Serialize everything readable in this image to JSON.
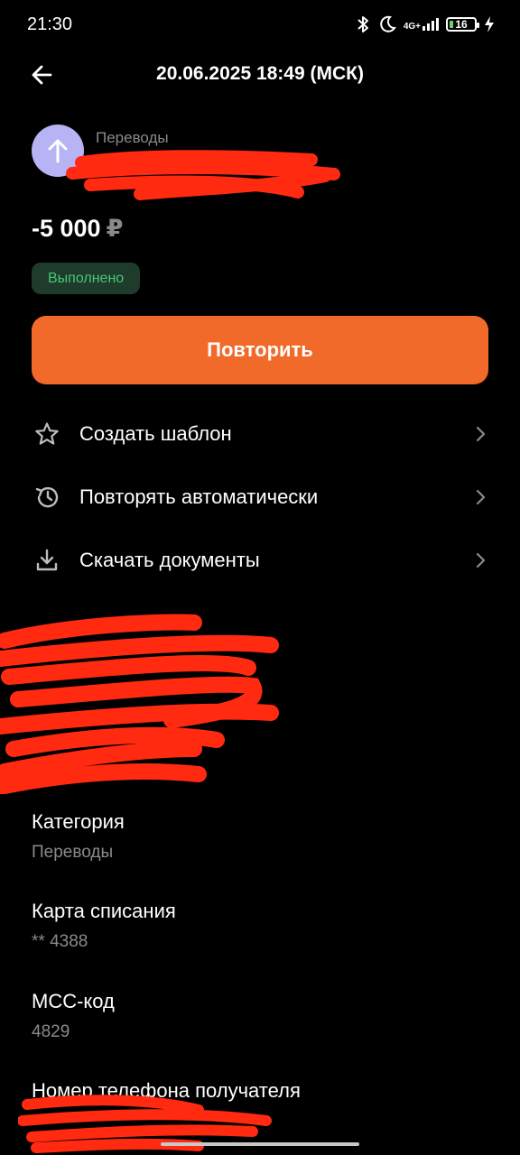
{
  "status_bar": {
    "time": "21:30",
    "network": "4G+",
    "battery": "16",
    "icons": [
      "bluetooth-icon",
      "moon-icon",
      "signal-icon",
      "battery-icon",
      "charging-icon"
    ]
  },
  "header": {
    "title": "20.06.2025 18:49 (МСК)",
    "back_icon": "arrow-left-icon"
  },
  "operation": {
    "category": "Переводы",
    "amount": "-5 000",
    "currency": "₽",
    "status": "Выполнено",
    "avatar_icon": "arrow-up-icon"
  },
  "repeat_button": "Повторить",
  "actions": [
    {
      "label": "Создать шаблон",
      "icon": "star-icon"
    },
    {
      "label": "Повторять автоматически",
      "icon": "history-icon"
    },
    {
      "label": "Скачать документы",
      "icon": "download-icon"
    }
  ],
  "details": [
    {
      "label": "Категория",
      "value": "Переводы"
    },
    {
      "label": "Карта списания",
      "value": "** 4388"
    },
    {
      "label": "MCC-код",
      "value": "4829"
    },
    {
      "label": "Номер телефона получателя",
      "value": ""
    }
  ],
  "colors": {
    "background": "#000000",
    "accent": "#f26a2a",
    "success_text": "#47c777",
    "success_bg": "#1e3b2c",
    "muted_text": "#8a8a8e",
    "avatar_bg": "#b7b3f4",
    "redaction": "#ff2a10"
  }
}
